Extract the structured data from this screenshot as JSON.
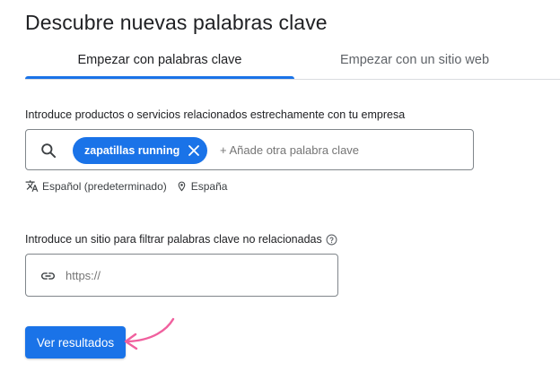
{
  "header": {
    "title": "Descubre nuevas palabras clave"
  },
  "tabs": [
    {
      "label": "Empezar con palabras clave",
      "active": true
    },
    {
      "label": "Empezar con un sitio web",
      "active": false
    }
  ],
  "keywords_section": {
    "label": "Introduce productos o servicios relacionados estrechamente con tu empresa",
    "chips": [
      {
        "label": "zapatillas running"
      }
    ],
    "placeholder": "+ Añade otra palabra clave",
    "language": "Español (predeterminado)",
    "location": "España"
  },
  "site_section": {
    "label": "Introduce un sitio para filtrar palabras clave no relacionadas",
    "placeholder": "https://"
  },
  "submit": {
    "label": "Ver resultados"
  },
  "colors": {
    "accent": "#1a73e8",
    "annotation_arrow": "#f0609e",
    "border": "#80868b",
    "divider": "#dadce0"
  },
  "icons": [
    "search-icon",
    "close-icon",
    "translate-icon",
    "location-pin-icon",
    "help-icon",
    "link-icon",
    "annotation-arrow"
  ]
}
